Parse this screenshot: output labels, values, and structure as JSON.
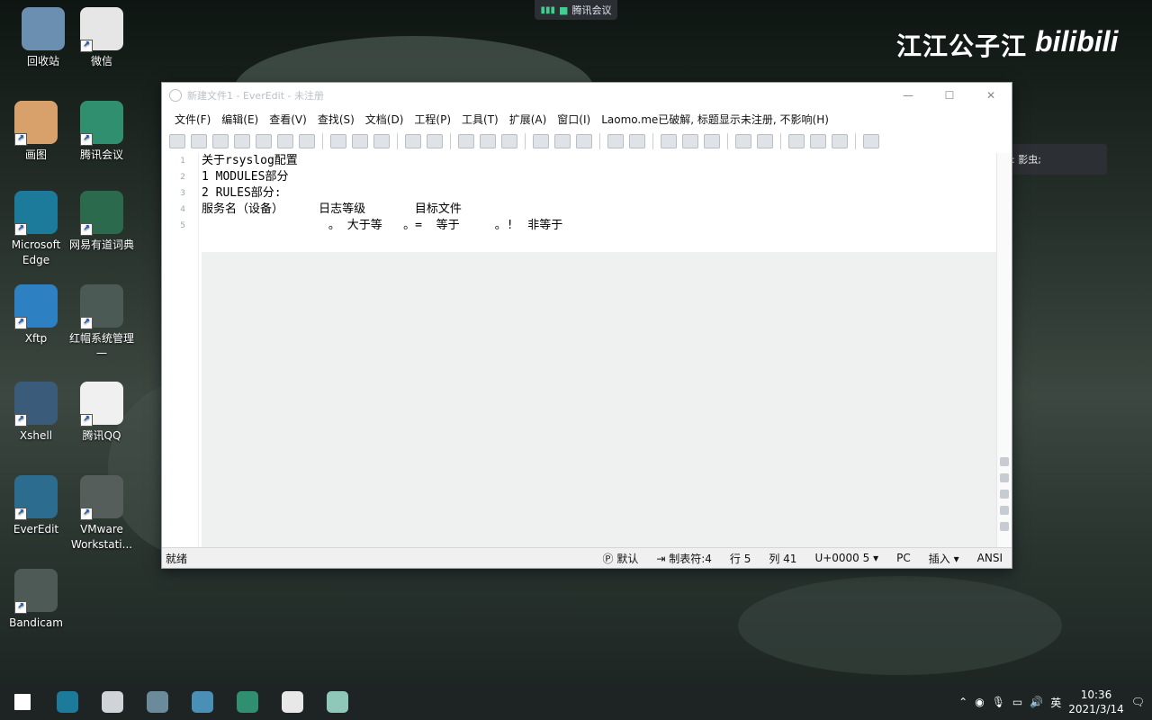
{
  "meeting_bar": {
    "label": "腾讯会议"
  },
  "watermark": {
    "channel": "江江公子江",
    "brand": "bilibili"
  },
  "speaking": {
    "label": "正在讲话: 影虫;"
  },
  "desktop_icons": [
    {
      "label": "回收站",
      "icon": "recycle-bin-icon",
      "color": "#6a8fb0"
    },
    {
      "label": "微信",
      "icon": "wechat-icon",
      "color": "#e6e6e6"
    },
    {
      "label": "画图",
      "icon": "paint-icon",
      "color": "#d8a06a"
    },
    {
      "label": "腾讯会议",
      "icon": "tencent-meeting-icon",
      "color": "#2f8f6e"
    },
    {
      "label": "Microsoft Edge",
      "icon": "edge-icon",
      "color": "#1c7a9b"
    },
    {
      "label": "网易有道词典",
      "icon": "youdao-icon",
      "color": "#2c6a4e"
    },
    {
      "label": "Xftp",
      "icon": "xftp-icon",
      "color": "#2d80c2"
    },
    {
      "label": "红帽系统管理一",
      "icon": "book-icon",
      "color": "#4b5a55"
    },
    {
      "label": "Xshell",
      "icon": "xshell-icon",
      "color": "#3a5c7a"
    },
    {
      "label": "腾讯QQ",
      "icon": "qq-icon",
      "color": "#f0f0f0"
    },
    {
      "label": "EverEdit",
      "icon": "everedit-icon",
      "color": "#2b6c8f"
    },
    {
      "label": "VMware Workstati...",
      "icon": "vmware-icon",
      "color": "#555e5a"
    },
    {
      "label": "Bandicam",
      "icon": "bandicam-icon",
      "color": "#4e5a56"
    }
  ],
  "window": {
    "title": "新建文件1 - EverEdit - 未注册",
    "menu": [
      "文件(F)",
      "编辑(E)",
      "查看(V)",
      "查找(S)",
      "文档(D)",
      "工程(P)",
      "工具(T)",
      "扩展(A)",
      "窗口(I)",
      "Laomo.me已破解, 标题显示未注册, 不影响(H)"
    ],
    "line_numbers": [
      "1",
      "2",
      "3",
      "4",
      "5"
    ],
    "lines": [
      "关于rsyslog配置",
      "1 MODULES部分",
      "2 RULES部分:",
      "服务名（设备）     日志等级       目标文件",
      "                  。 大于等   。=  等于     。!  非等于"
    ],
    "status": {
      "ready": "就绪",
      "mode": "默认",
      "tab": "制表符:4",
      "line": "行 5",
      "col": "列 41",
      "unicode": "U+0000",
      "value": "5",
      "eol": "PC",
      "insert": "插入",
      "encoding": "ANSI"
    }
  },
  "taskbar": {
    "icons": [
      "windows-start-icon",
      "edge-icon",
      "explorer-icon",
      "vmware-icon",
      "xshell-icon",
      "tencent-meeting-icon",
      "obs-icon",
      "everedit-icon"
    ],
    "ime": "英",
    "time": "10:36",
    "date": "2021/3/14"
  }
}
